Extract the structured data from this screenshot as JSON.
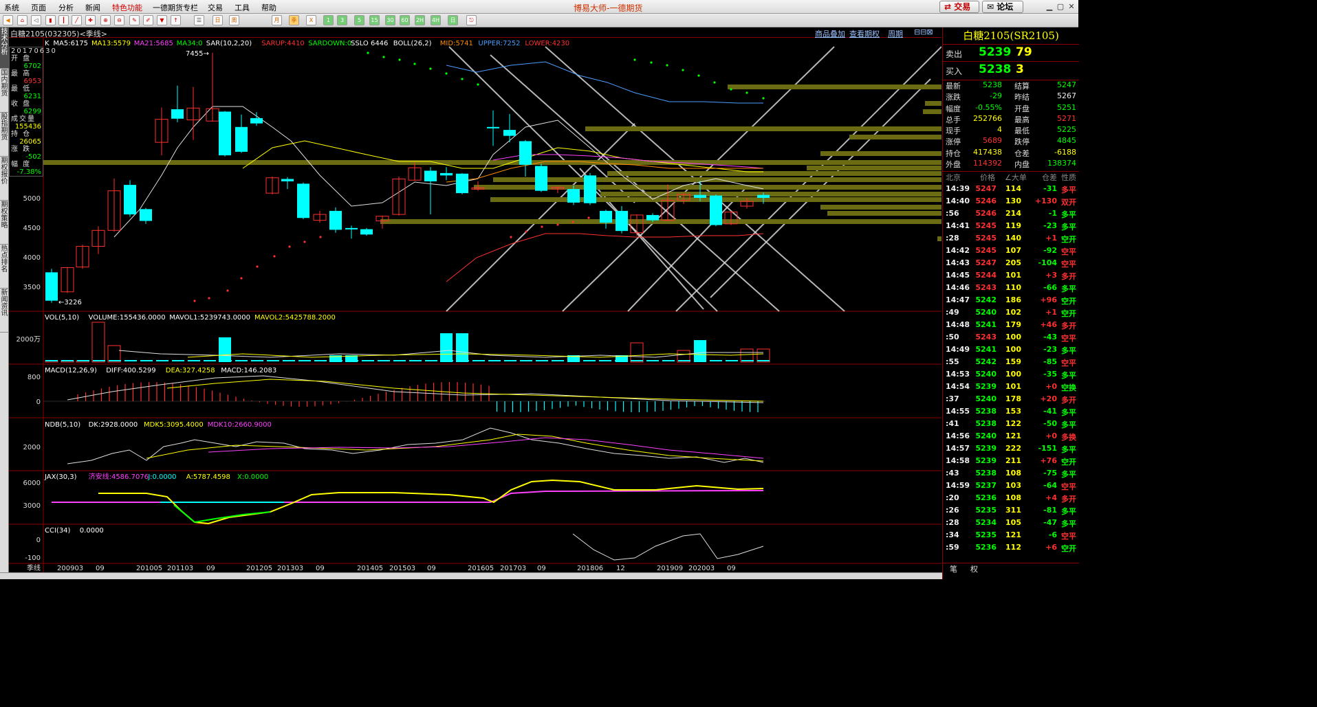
{
  "menu": {
    "items": [
      "系统",
      "页面",
      "分析",
      "新闻",
      "特色功能",
      "一德期货专栏",
      "交易",
      "工具",
      "帮助"
    ],
    "app_title": "博易大师-一德期货",
    "trade_btn": "交易",
    "forum_btn": "论坛"
  },
  "toolbar": {
    "buttons": [
      "home",
      "back",
      "bar",
      "line",
      "draw",
      "zoom-in",
      "zoom-out",
      "pen",
      "pen2",
      "brush",
      "brush2",
      "filter",
      "up",
      "list",
      "cal-day",
      "cal-week",
      "cal-month",
      "quarter",
      "x",
      "1",
      "3",
      "5",
      "15",
      "30",
      "60",
      "2h",
      "4h",
      "day",
      "calendar",
      "exit"
    ],
    "labels": {
      "day": "日",
      "week": "周",
      "month": "月",
      "quarter": "季",
      "x": "X",
      "1": "1",
      "3": "3",
      "5": "5",
      "15": "15",
      "30": "30",
      "60": "60",
      "2h": "2H",
      "4h": "4H",
      "cal": "日"
    }
  },
  "left_tabs": [
    "技术分析",
    "国内期货",
    "股指期货",
    "期权报价",
    "期权策略",
    "热点排名",
    "新闻资讯"
  ],
  "chart": {
    "name": "白糖2105(032305)<季线>",
    "right_links": [
      "商品叠加",
      "查看期权",
      "周期"
    ],
    "main_indicators": [
      {
        "text": "K",
        "color": "#ffffff"
      },
      {
        "text": "MA5:6175",
        "color": "#ffffff"
      },
      {
        "text": "MA13:5579",
        "color": "#ffff00"
      },
      {
        "text": "MA21:5685",
        "color": "#ff40ff"
      },
      {
        "text": "MA34:0",
        "color": "#00ff00"
      },
      {
        "text": "SAR(10,2,20)",
        "color": "#ffffff"
      },
      {
        "text": "SARUP:4410",
        "color": "#ff3030"
      },
      {
        "text": "SARDOWN:0",
        "color": "#00ff00"
      },
      {
        "text": "SSLO 6446",
        "color": "#ffffff"
      },
      {
        "text": "BOLL(26,2)",
        "color": "#ffffff"
      },
      {
        "text": "MID:5741",
        "color": "#ff8c00"
      },
      {
        "text": "UPPER:7252",
        "color": "#4a9eff"
      },
      {
        "text": "LOWER:4230",
        "color": "#ff3030"
      }
    ],
    "high_label": "7455",
    "low_label": "3226",
    "y_ticks": [
      "5000",
      "4500",
      "4000",
      "3500"
    ],
    "infobox": [
      {
        "label": "20170630",
        "value": "",
        "color": "#ffffff"
      },
      {
        "label": "开 盘",
        "value": "6702",
        "color": "#00ff00"
      },
      {
        "label": "最 高",
        "value": "6953",
        "color": "#ff3030"
      },
      {
        "label": "最 低",
        "value": "6231",
        "color": "#00ff00"
      },
      {
        "label": "收 盘",
        "value": "6299",
        "color": "#00ff00"
      },
      {
        "label": "成交量",
        "value": "155436",
        "color": "#ffff00"
      },
      {
        "label": "持 仓",
        "value": "26065",
        "color": "#ffff00"
      },
      {
        "label": "涨 跌",
        "value": "-502",
        "color": "#00ff00"
      },
      {
        "label": "幅 度",
        "value": "-7.38%",
        "color": "#00ff00"
      }
    ],
    "vol": {
      "title": "VOL(5,10)",
      "items": [
        {
          "text": "VOLUME:155436.0000",
          "color": "#ffffff"
        },
        {
          "text": "MAVOL1:5239743.0000",
          "color": "#ffffff"
        },
        {
          "text": "MAVOL2:5425788.2000",
          "color": "#ffff00"
        }
      ],
      "y_tick": "2000万"
    },
    "macd": {
      "title": "MACD(12,26,9)",
      "items": [
        {
          "text": "DIFF:400.5299",
          "color": "#ffffff"
        },
        {
          "text": "DEA:327.4258",
          "color": "#ffff00"
        },
        {
          "text": "MACD:146.2083",
          "color": "#ffffff"
        }
      ],
      "y_ticks": [
        "800",
        "0"
      ]
    },
    "ndb": {
      "title": "NDB(5,10)",
      "items": [
        {
          "text": "DK:2928.0000",
          "color": "#ffffff"
        },
        {
          "text": "MDK5:3095.4000",
          "color": "#ffff00"
        },
        {
          "text": "MDK10:2660.9000",
          "color": "#ff40ff"
        }
      ],
      "y_tick": "2000"
    },
    "jax": {
      "title": "JAX(30,3)",
      "items": [
        {
          "text": "济安线:4586.7076",
          "color": "#ff40ff"
        },
        {
          "text": "J:0.0000",
          "color": "#00ffff"
        },
        {
          "text": "A:5787.4598",
          "color": "#ffff00"
        },
        {
          "text": "X:0.0000",
          "color": "#00ff00"
        }
      ],
      "y_ticks": [
        "6000",
        "3000"
      ]
    },
    "cci": {
      "title": "CCI(34)",
      "items": [
        {
          "text": "0.0000",
          "color": "#ffffff"
        }
      ],
      "y_ticks": [
        "0",
        "-100"
      ]
    },
    "period_label": "季线",
    "x_labels": [
      "200903",
      "09",
      "201005",
      "201103",
      "09",
      "201205",
      "201303",
      "09",
      "201405",
      "201503",
      "09",
      "201605",
      "201703",
      "09",
      "201806",
      "12",
      "201909",
      "202003",
      "09"
    ]
  },
  "quote": {
    "title": "白糖2105(SR2105)",
    "sell_label": "卖出",
    "sell_price": "5239",
    "sell_vol": "79",
    "buy_label": "买入",
    "buy_price": "5238",
    "buy_vol": "3",
    "rows": [
      {
        "l1": "最新",
        "v1": "5238",
        "c1": "#00ff00",
        "l2": "结算",
        "v2": "5247",
        "c2": "#00ff00"
      },
      {
        "l1": "涨跌",
        "v1": "-29",
        "c1": "#00ff00",
        "l2": "昨结",
        "v2": "5267",
        "c2": "#eeeeee"
      },
      {
        "l1": "幅度",
        "v1": "-0.55%",
        "c1": "#00ff00",
        "l2": "开盘",
        "v2": "5251",
        "c2": "#00ff00"
      },
      {
        "l1": "总手",
        "v1": "252766",
        "c1": "#ffff00",
        "l2": "最高",
        "v2": "5271",
        "c2": "#ff3030"
      },
      {
        "l1": "现手",
        "v1": "4",
        "c1": "#ffff00",
        "l2": "最低",
        "v2": "5225",
        "c2": "#00ff00"
      },
      {
        "l1": "涨停",
        "v1": "5689",
        "c1": "#ff3030",
        "l2": "跌停",
        "v2": "4845",
        "c2": "#00ff00"
      },
      {
        "l1": "持仓",
        "v1": "417438",
        "c1": "#ffff00",
        "l2": "仓差",
        "v2": "-6188",
        "c2": "#ffff00"
      },
      {
        "l1": "外盘",
        "v1": "114392",
        "c1": "#ff3030",
        "l2": "内盘",
        "v2": "138374",
        "c2": "#00ff00"
      }
    ],
    "ticks_header": {
      "time": "北京",
      "price": "价格",
      "vol": "∠大单",
      "chg": "仓差",
      "nature": "性质"
    },
    "ticks": [
      {
        "t": "14:39",
        "p": "5247",
        "v": "114",
        "c": "-31",
        "n": "多平",
        "nc": "#ff3030"
      },
      {
        "t": "14:40",
        "p": "5246",
        "v": "130",
        "c": "+130",
        "n": "双开",
        "nc": "#ff3030"
      },
      {
        "t": ":56",
        "p": "5246",
        "v": "214",
        "c": "-1",
        "n": "多平",
        "nc": "#00ff00"
      },
      {
        "t": "14:41",
        "p": "5245",
        "v": "119",
        "c": "-23",
        "n": "多平",
        "nc": "#00ff00"
      },
      {
        "t": ":28",
        "p": "5245",
        "v": "140",
        "c": "+1",
        "n": "空开",
        "nc": "#00ff00"
      },
      {
        "t": "14:42",
        "p": "5245",
        "v": "107",
        "c": "-92",
        "n": "空平",
        "nc": "#ff3030"
      },
      {
        "t": "14:43",
        "p": "5247",
        "v": "205",
        "c": "-104",
        "n": "空平",
        "nc": "#ff3030"
      },
      {
        "t": "14:45",
        "p": "5244",
        "v": "101",
        "c": "+3",
        "n": "多开",
        "nc": "#ff3030"
      },
      {
        "t": "14:46",
        "p": "5243",
        "v": "110",
        "c": "-66",
        "n": "多平",
        "nc": "#00ff00"
      },
      {
        "t": "14:47",
        "p": "5242",
        "v": "186",
        "c": "+96",
        "n": "空开",
        "nc": "#00ff00"
      },
      {
        "t": ":49",
        "p": "5240",
        "v": "102",
        "c": "+1",
        "n": "空开",
        "nc": "#00ff00"
      },
      {
        "t": "14:48",
        "p": "5241",
        "v": "179",
        "c": "+46",
        "n": "多开",
        "nc": "#ff3030"
      },
      {
        "t": ":50",
        "p": "5243",
        "v": "100",
        "c": "-43",
        "n": "空平",
        "nc": "#ff3030"
      },
      {
        "t": "14:49",
        "p": "5241",
        "v": "100",
        "c": "-23",
        "n": "多平",
        "nc": "#00ff00"
      },
      {
        "t": ":55",
        "p": "5242",
        "v": "159",
        "c": "-85",
        "n": "空平",
        "nc": "#ff3030"
      },
      {
        "t": "14:53",
        "p": "5240",
        "v": "100",
        "c": "-35",
        "n": "多平",
        "nc": "#00ff00"
      },
      {
        "t": "14:54",
        "p": "5239",
        "v": "101",
        "c": "+0",
        "n": "空换",
        "nc": "#00ff00"
      },
      {
        "t": ":37",
        "p": "5240",
        "v": "178",
        "c": "+20",
        "n": "多开",
        "nc": "#ff3030"
      },
      {
        "t": "14:55",
        "p": "5238",
        "v": "153",
        "c": "-41",
        "n": "多平",
        "nc": "#00ff00"
      },
      {
        "t": ":41",
        "p": "5238",
        "v": "122",
        "c": "-50",
        "n": "多平",
        "nc": "#00ff00"
      },
      {
        "t": "14:56",
        "p": "5240",
        "v": "121",
        "c": "+0",
        "n": "多换",
        "nc": "#ff3030"
      },
      {
        "t": "14:57",
        "p": "5239",
        "v": "222",
        "c": "-151",
        "n": "多平",
        "nc": "#00ff00"
      },
      {
        "t": "14:58",
        "p": "5239",
        "v": "211",
        "c": "+76",
        "n": "空开",
        "nc": "#00ff00"
      },
      {
        "t": ":43",
        "p": "5238",
        "v": "108",
        "c": "-75",
        "n": "多平",
        "nc": "#00ff00"
      },
      {
        "t": "14:59",
        "p": "5237",
        "v": "103",
        "c": "-64",
        "n": "空平",
        "nc": "#ff3030"
      },
      {
        "t": ":20",
        "p": "5236",
        "v": "108",
        "c": "+4",
        "n": "多开",
        "nc": "#ff3030"
      },
      {
        "t": ":26",
        "p": "5235",
        "v": "311",
        "c": "-81",
        "n": "多平",
        "nc": "#00ff00"
      },
      {
        "t": ":28",
        "p": "5234",
        "v": "105",
        "c": "-47",
        "n": "多平",
        "nc": "#00ff00"
      },
      {
        "t": ":34",
        "p": "5235",
        "v": "121",
        "c": "-6",
        "n": "空平",
        "nc": "#ff3030"
      },
      {
        "t": ":59",
        "p": "5236",
        "v": "112",
        "c": "+6",
        "n": "空开",
        "nc": "#00ff00"
      }
    ],
    "bottom_tabs": [
      "笔",
      "权"
    ]
  },
  "colors": {
    "up": "#ff3030",
    "down": "#00ffff",
    "grid": "#8b0000",
    "bg": "#000000"
  }
}
